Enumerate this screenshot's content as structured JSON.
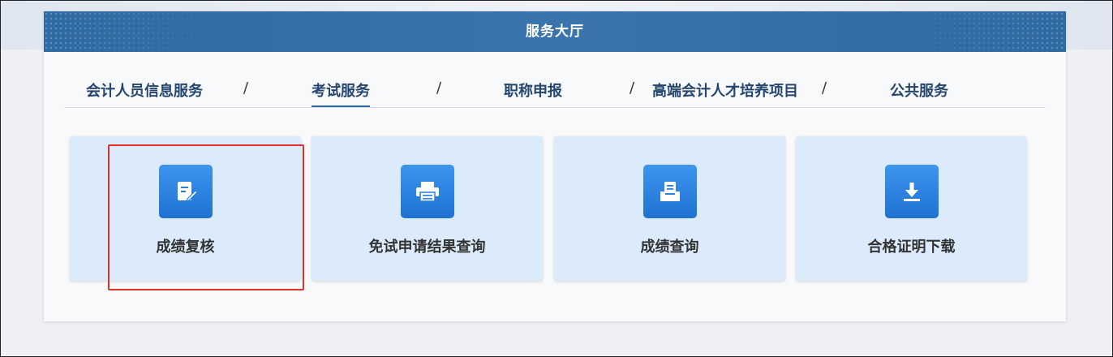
{
  "header": {
    "title": "服务大厅"
  },
  "tabs": [
    {
      "label": "会计人员信息服务"
    },
    {
      "label": "考试服务"
    },
    {
      "label": "职称申报"
    },
    {
      "label": "高端会计人才培养项目"
    },
    {
      "label": "公共服务"
    }
  ],
  "separator": "/",
  "active_tab_index": 1,
  "cards": [
    {
      "label": "成绩复核",
      "icon": "edit-document-icon"
    },
    {
      "label": "免试申请结果查询",
      "icon": "printer-icon"
    },
    {
      "label": "成绩查询",
      "icon": "inbox-document-icon"
    },
    {
      "label": "合格证明下载",
      "icon": "download-icon"
    }
  ],
  "colors": {
    "header_bg": "#2f6aa3",
    "tab_text": "#24466e",
    "card_bg": "#dcebfb",
    "icon_bg": "#2a83e3",
    "highlight": "#e0302a"
  }
}
